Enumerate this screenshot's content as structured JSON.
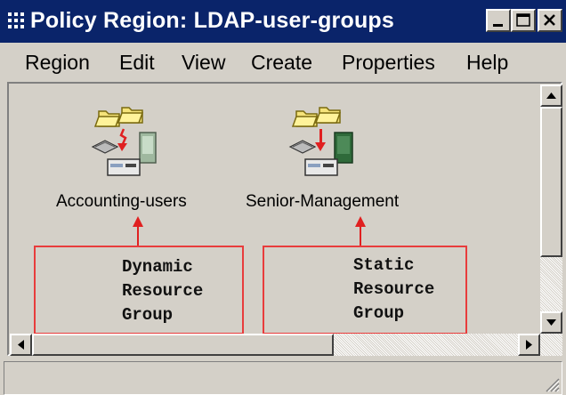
{
  "window": {
    "title": "Policy Region: LDAP-user-groups",
    "title_bar_color": "#0a246a",
    "controls": [
      "minimize-icon",
      "maximize-icon",
      "close-icon"
    ]
  },
  "menu": {
    "items": [
      "Region",
      "Edit",
      "View",
      "Create",
      "Properties",
      "Help"
    ]
  },
  "resources": [
    {
      "label": "Accounting-users",
      "icon": "dynamic-resource-group-icon"
    },
    {
      "label": "Senior-Management",
      "icon": "static-resource-group-icon"
    }
  ],
  "callouts": [
    {
      "text": "Dynamic\nResource\nGroup",
      "border_color": "#e83c3c"
    },
    {
      "text": "Static\nResource\nGroup",
      "border_color": "#e83c3c"
    }
  ]
}
